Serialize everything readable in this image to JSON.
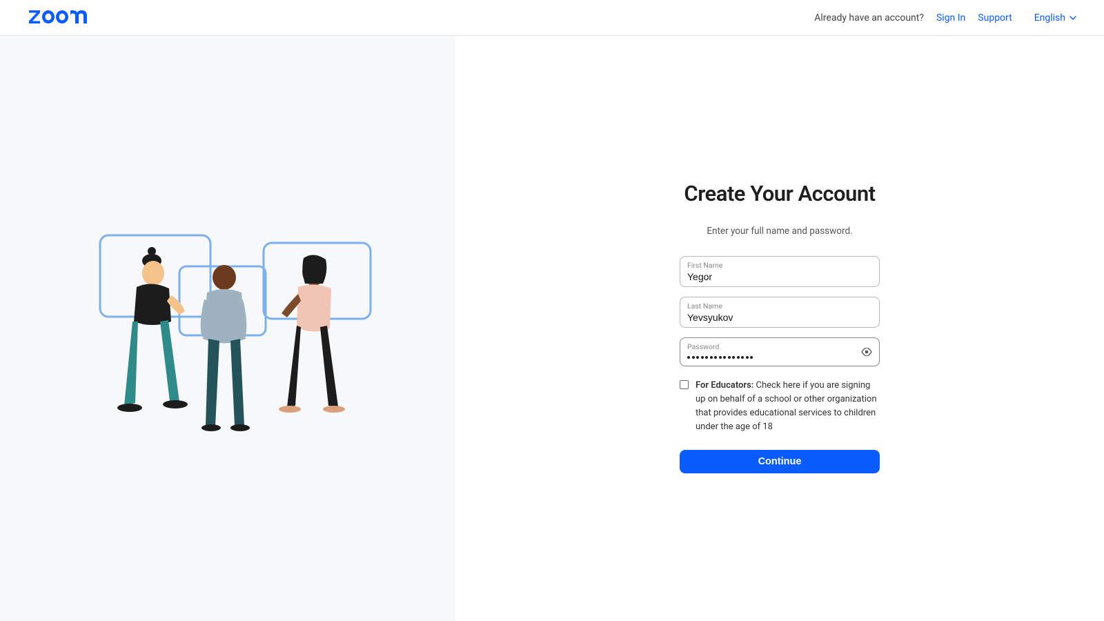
{
  "header": {
    "already_text": "Already have an account?",
    "sign_in": "Sign In",
    "support": "Support",
    "language": "English"
  },
  "page": {
    "title": "Create Your Account",
    "subtitle": "Enter your full name and password."
  },
  "form": {
    "first_name": {
      "label": "First Name",
      "value": "Yegor"
    },
    "last_name": {
      "label": "Last Name",
      "value": "Yevsyukov"
    },
    "password": {
      "label": "Password",
      "dots": 15
    },
    "educators_bold": "For Educators:",
    "educators_rest": " Check here if you are signing up on behalf of a school or other organization that provides educational services to children under the age of 18",
    "continue": "Continue"
  }
}
